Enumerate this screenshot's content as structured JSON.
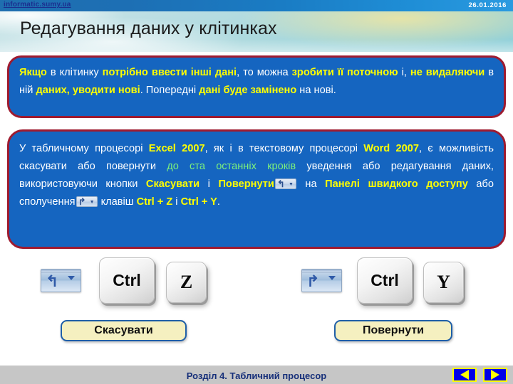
{
  "header": {
    "site_link": "informatic.sumy.ua",
    "date": "26.01.2016",
    "title": "Редагування даних у клітинках"
  },
  "box1": {
    "segments": [
      {
        "text": "Якщо",
        "style": "hl"
      },
      {
        "text": " в клітинку ",
        "style": "plain"
      },
      {
        "text": "потрібно ввести інші дані",
        "style": "hl"
      },
      {
        "text": ", то можна ",
        "style": "plain"
      },
      {
        "text": "зробити її поточною",
        "style": "hl"
      },
      {
        "text": " і, ",
        "style": "plain"
      },
      {
        "text": "не видаляючи",
        "style": "hl"
      },
      {
        "text": " в ній ",
        "style": "plain"
      },
      {
        "text": "даних, уводити нові",
        "style": "hl"
      },
      {
        "text": ". Попередні ",
        "style": "plain"
      },
      {
        "text": "дані буде замінено",
        "style": "hl"
      },
      {
        "text": " на нові.",
        "style": "plain"
      }
    ]
  },
  "box2": {
    "segments": [
      {
        "text": "У табличному процесорі ",
        "style": "plain"
      },
      {
        "text": "Excel 2007",
        "style": "hl"
      },
      {
        "text": ", як і в текстовому процесорі ",
        "style": "plain"
      },
      {
        "text": "Word 2007",
        "style": "hl"
      },
      {
        "text": ", є можливість скасувати або повернути ",
        "style": "plain"
      },
      {
        "text": "до ста останніх кроків",
        "style": "hl-green"
      },
      {
        "text": " уведення або редагування даних, використовуючи кнопки ",
        "style": "plain"
      },
      {
        "text": "Скасувати",
        "style": "hl"
      },
      {
        "text": " і ",
        "style": "plain"
      },
      {
        "text": "Повернути",
        "style": "hl"
      },
      {
        "text": " ",
        "style": "icon-undo"
      },
      {
        "text": " на ",
        "style": "plain"
      },
      {
        "text": "Панелі швидкого доступу",
        "style": "hl"
      },
      {
        "text": " або сполучення",
        "style": "plain"
      },
      {
        "text": " ",
        "style": "icon-redo"
      },
      {
        "text": " клавіш ",
        "style": "plain"
      },
      {
        "text": "Ctrl + Z",
        "style": "hl"
      },
      {
        "text": " і ",
        "style": "plain"
      },
      {
        "text": "Ctrl + Y",
        "style": "hl"
      },
      {
        "text": ".",
        "style": "plain"
      }
    ]
  },
  "graphics": {
    "undo_button_icon": "undo-arrow-icon",
    "redo_button_icon": "redo-arrow-icon",
    "undo_chevron": "chevron-down-icon",
    "redo_chevron": "chevron-down-icon",
    "key_ctrl_left": "Ctrl",
    "key_z": "Z",
    "key_ctrl_right": "Ctrl",
    "key_y": "Y",
    "undo_label": "Скасувати",
    "redo_label": "Повернути",
    "undo_glyph": "↰",
    "redo_glyph": "↱"
  },
  "footer": {
    "section_text": "Розділ 4. Табличний процесор",
    "prev_icon": "triangle-left-icon",
    "next_icon": "triangle-right-icon"
  },
  "colors": {
    "callout_fill": "#1565c0",
    "callout_border": "#9e1b30",
    "highlight_yellow": "#ffff00",
    "highlight_green": "#7cf07c",
    "pill_fill": "#f5f0c0",
    "pill_border": "#1f5fa8",
    "nav_fill": "#0000e6",
    "nav_border": "#ffff00",
    "footer_band": "#c6c6c6",
    "header_band": "#1a7cc4"
  }
}
